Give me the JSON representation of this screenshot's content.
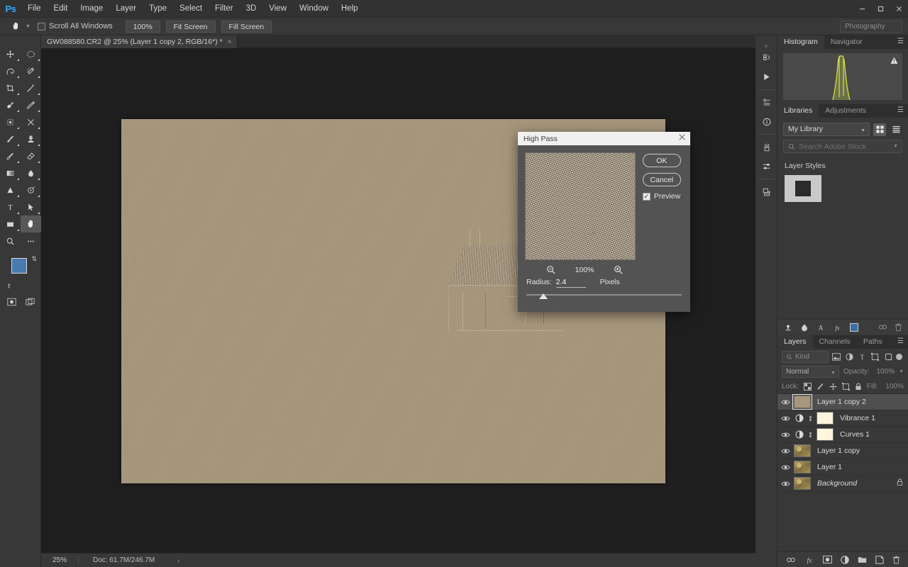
{
  "app": {
    "logo": "Ps",
    "menus": [
      "File",
      "Edit",
      "Image",
      "Layer",
      "Type",
      "Select",
      "Filter",
      "3D",
      "View",
      "Window",
      "Help"
    ],
    "window_controls": {
      "minimize": "—",
      "maximize": "☐",
      "close": "✕"
    }
  },
  "options_bar": {
    "tool_icon": "hand-tool-icon",
    "scroll_all_windows_label": "Scroll All Windows",
    "scroll_all_windows_checked": false,
    "zoom_100_label": "100%",
    "fit_screen_label": "Fit Screen",
    "fill_screen_label": "Fill Screen",
    "workspace_label": "Photography"
  },
  "toolbar": {
    "tools": [
      {
        "name": "move-tool",
        "glyph": "✥",
        "has_submenu": true
      },
      {
        "name": "elliptical-marquee-tool",
        "glyph": "○",
        "has_submenu": true
      },
      {
        "name": "lasso-tool",
        "glyph": "⌇",
        "has_submenu": true
      },
      {
        "name": "magic-wand-tool",
        "glyph": "✦",
        "has_submenu": true
      },
      {
        "name": "crop-tool",
        "glyph": "⌗",
        "has_submenu": true
      },
      {
        "name": "eyedropper-tool",
        "glyph": "✒",
        "has_submenu": true
      },
      {
        "name": "spot-healing-brush-tool",
        "glyph": "❦",
        "has_submenu": true
      },
      {
        "name": "patch-tool",
        "glyph": "╱",
        "has_submenu": true
      },
      {
        "name": "content-aware-move-tool",
        "glyph": "▦",
        "has_submenu": true
      },
      {
        "name": "red-eye-tool",
        "glyph": "✖",
        "has_submenu": true
      },
      {
        "name": "brush-tool",
        "glyph": "✐",
        "has_submenu": true
      },
      {
        "name": "clone-stamp-tool",
        "glyph": "⚑",
        "has_submenu": true
      },
      {
        "name": "history-brush-tool",
        "glyph": "✎",
        "has_submenu": true
      },
      {
        "name": "eraser-tool",
        "glyph": "▱",
        "has_submenu": true
      },
      {
        "name": "gradient-tool",
        "glyph": "▤",
        "has_submenu": true
      },
      {
        "name": "blur-tool",
        "glyph": "●",
        "has_submenu": true
      },
      {
        "name": "dodge-tool",
        "glyph": "▲",
        "has_submenu": true
      },
      {
        "name": "pen-tool",
        "glyph": "✑",
        "has_submenu": true
      },
      {
        "name": "type-tool",
        "glyph": "T",
        "has_submenu": true
      },
      {
        "name": "path-selection-tool",
        "glyph": "➤",
        "has_submenu": true
      },
      {
        "name": "rectangle-tool",
        "glyph": "▭",
        "has_submenu": true
      },
      {
        "name": "hand-tool",
        "glyph": "✋",
        "has_submenu": false,
        "active": true
      },
      {
        "name": "zoom-tool",
        "glyph": "⚲",
        "has_submenu": false
      },
      {
        "name": "edit-toolbar-tool",
        "glyph": "⋯",
        "has_submenu": false
      }
    ],
    "foreground_color": "#4a7ab0",
    "background_color": "#cbb894",
    "swap_colors_icon": "swap-colors-icon",
    "default_colors_icon": "default-colors-icon",
    "quick_mask_icon": "quick-mask-icon",
    "screen_mode_icon": "screen-mode-icon"
  },
  "document": {
    "tab_title": "GW088580.CR2 @ 25% (Layer 1 copy 2, RGB/16*) *",
    "close_glyph": "×"
  },
  "status_bar": {
    "zoom": "25%",
    "doc_info": "Doc: 61.7M/246.7M",
    "arrow": "›"
  },
  "rail": {
    "icons": [
      {
        "name": "history-icon",
        "glyph": "↺"
      },
      {
        "name": "actions-play-icon",
        "glyph": "▶"
      },
      {
        "name": "properties-icon",
        "glyph": "☰"
      },
      {
        "name": "info-icon",
        "glyph": "ⓘ"
      },
      {
        "name": "brush-presets-icon",
        "glyph": "❀"
      },
      {
        "name": "brush-settings-icon",
        "glyph": "☰"
      },
      {
        "name": "clone-source-icon",
        "glyph": "⎙"
      }
    ]
  },
  "histogram_panel": {
    "tabs": [
      {
        "label": "Histogram",
        "active": true
      },
      {
        "label": "Navigator",
        "active": false
      }
    ],
    "menu_icon": "panel-menu-icon",
    "warning_icon": "histogram-warning-icon"
  },
  "libraries_panel": {
    "tabs": [
      {
        "label": "Libraries",
        "active": true
      },
      {
        "label": "Adjustments",
        "active": false
      }
    ],
    "menu_icon": "panel-menu-icon",
    "library_selected": "My Library",
    "grid_view_icon": "grid-view-icon",
    "list_view_icon": "list-view-icon",
    "search_placeholder": "Search Adobe Stock",
    "search_value": "",
    "section_label": "Layer Styles",
    "toolbar_icons": [
      {
        "name": "add-graphic-icon",
        "glyph": "↑"
      },
      {
        "name": "add-color-icon",
        "glyph": "◕"
      },
      {
        "name": "add-text-style-icon",
        "glyph": "A"
      },
      {
        "name": "add-layer-style-icon",
        "glyph": "ƒx"
      },
      {
        "name": "color-swatch-icon",
        "glyph": ""
      },
      {
        "name": "sync-icon",
        "glyph": "⚭"
      },
      {
        "name": "delete-icon",
        "glyph": "Ὕ1"
      }
    ]
  },
  "layers_panel": {
    "tabs": [
      {
        "label": "Layers",
        "active": true
      },
      {
        "label": "Channels",
        "active": false
      },
      {
        "label": "Paths",
        "active": false
      }
    ],
    "menu_icon": "panel-menu-icon",
    "filter_kind_label": "Kind",
    "filter_icons": [
      {
        "name": "filter-pixel-icon",
        "glyph": "▣"
      },
      {
        "name": "filter-adjustment-icon",
        "glyph": "◐"
      },
      {
        "name": "filter-type-icon",
        "glyph": "T"
      },
      {
        "name": "filter-shape-icon",
        "glyph": "◱"
      },
      {
        "name": "filter-smart-object-icon",
        "glyph": "◨"
      }
    ],
    "blend_mode": "Normal",
    "opacity_label": "Opacity:",
    "opacity_value": "100%",
    "lock_label": "Lock:",
    "lock_icons": [
      {
        "name": "lock-transparent-pixels-icon",
        "glyph": "▒"
      },
      {
        "name": "lock-image-pixels-icon",
        "glyph": "✐"
      },
      {
        "name": "lock-position-icon",
        "glyph": "✥"
      },
      {
        "name": "lock-artboard-icon",
        "glyph": "◱"
      },
      {
        "name": "lock-all-icon",
        "glyph": "ὑ2"
      }
    ],
    "fill_label": "Fill:",
    "fill_value": "100%",
    "layers": [
      {
        "name": "Layer 1 copy 2",
        "type": "flat",
        "visible": true,
        "selected": true,
        "locked": false,
        "italic": false,
        "has_mask": false
      },
      {
        "name": "Vibrance 1",
        "type": "adjustment",
        "visible": true,
        "selected": false,
        "locked": false,
        "italic": false,
        "has_mask": true
      },
      {
        "name": "Curves 1",
        "type": "adjustment",
        "visible": true,
        "selected": false,
        "locked": false,
        "italic": false,
        "has_mask": true
      },
      {
        "name": "Layer 1 copy",
        "type": "photo",
        "visible": true,
        "selected": false,
        "locked": false,
        "italic": false,
        "has_mask": false
      },
      {
        "name": "Layer 1",
        "type": "photo",
        "visible": true,
        "selected": false,
        "locked": false,
        "italic": false,
        "has_mask": false
      },
      {
        "name": "Background",
        "type": "photo",
        "visible": true,
        "selected": false,
        "locked": true,
        "italic": true,
        "has_mask": false
      }
    ],
    "eye_glyph": "◉",
    "lock_badge_glyph": "ὑ2",
    "toolbar_icons": [
      {
        "name": "link-layers-icon",
        "glyph": "⚭"
      },
      {
        "name": "layer-style-icon",
        "glyph": "ƒx"
      },
      {
        "name": "add-layer-mask-icon",
        "glyph": "▣"
      },
      {
        "name": "new-adjustment-layer-icon",
        "glyph": "◐"
      },
      {
        "name": "new-group-icon",
        "glyph": "▰"
      },
      {
        "name": "new-layer-icon",
        "glyph": "⧉"
      },
      {
        "name": "delete-layer-icon",
        "glyph": "Ὕ1"
      }
    ]
  },
  "high_pass_dialog": {
    "title": "High Pass",
    "close_glyph": "✕",
    "ok_label": "OK",
    "cancel_label": "Cancel",
    "preview_label": "Preview",
    "preview_checked": true,
    "checkmark": "✓",
    "zoom_out_icon": "zoom-out-icon",
    "zoom_in_icon": "zoom-in-icon",
    "zoom_level": "100%",
    "radius_label": "Radius:",
    "radius_value": "2.4",
    "radius_units": "Pixels"
  }
}
